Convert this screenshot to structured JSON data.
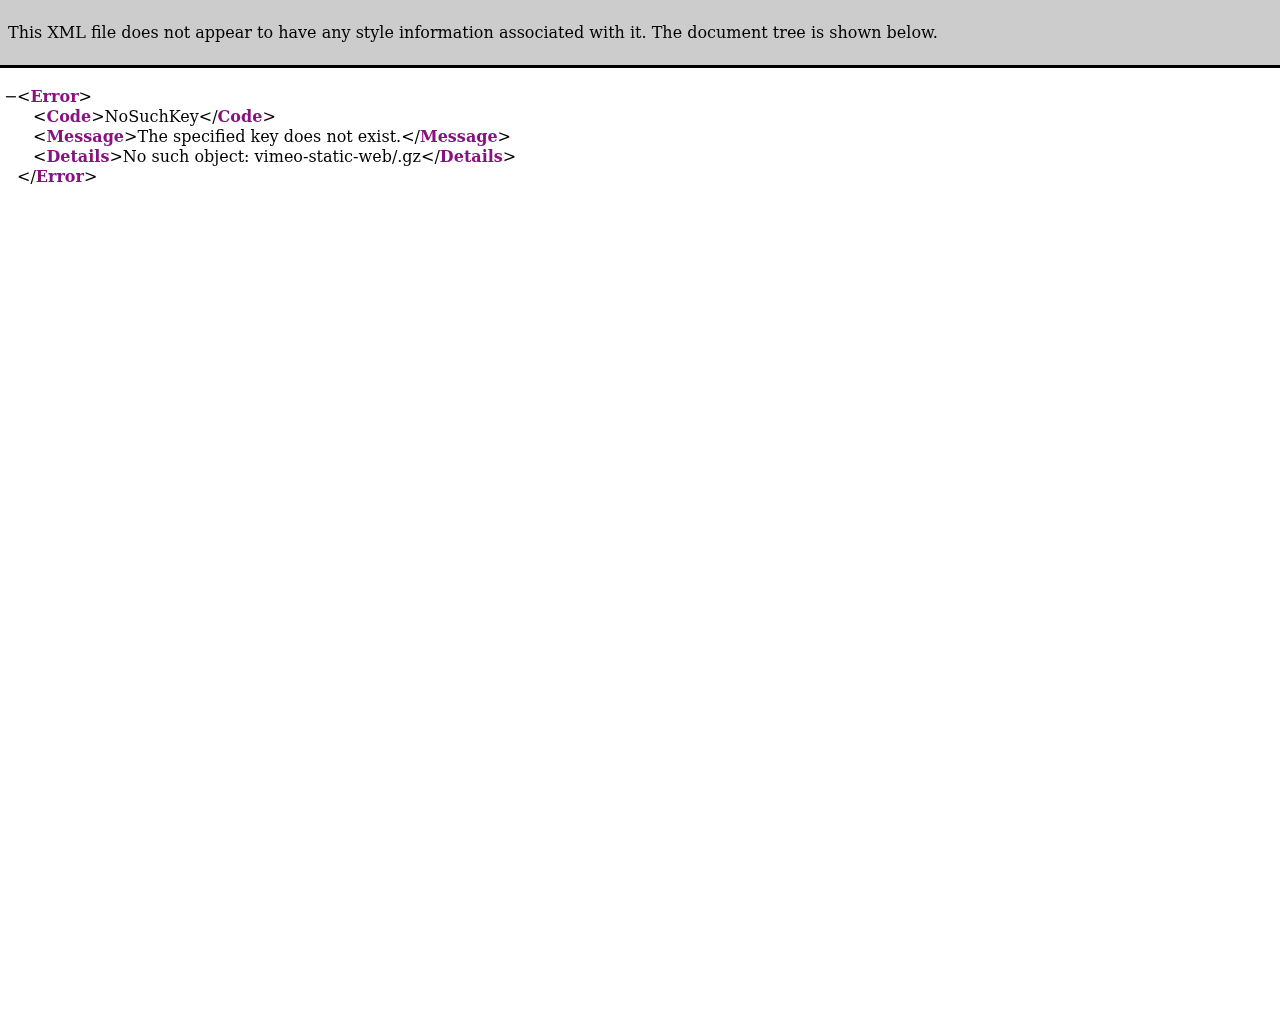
{
  "banner": {
    "text": "This XML file does not appear to have any style information associated with it. The document tree is shown below."
  },
  "tree": {
    "toggle": "−",
    "open_line": "<**Error**>",
    "children": [
      "<**Code**>NoSuchKey</**Code**>",
      "<**Message**>The specified key does not exist.</**Message**>",
      "<**Details**>No such object: vimeo-static-web/.gz</**Details**>"
    ],
    "close_line": "</**Error**>"
  }
}
